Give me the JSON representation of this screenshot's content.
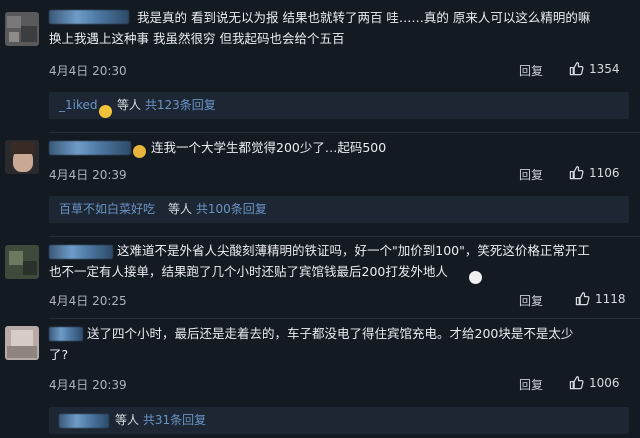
{
  "comments": [
    {
      "content": "我是真的 看到说无以为报 结果也就转了两百 哇……真的 原来人可以这么精明的嘛\n换上我遇上这种事 我虽然很穷 但我起码也会给个五百",
      "date": "4月4日 20:30",
      "reply_label": "回复",
      "likes": "1354",
      "replies": {
        "name": "_1iked",
        "middle": "等人",
        "link": "共123条回复"
      }
    },
    {
      "content": "连我一个大学生都觉得200少了…起码500",
      "date": "4月4日 20:39",
      "reply_label": "回复",
      "likes": "1106",
      "replies": {
        "name": "百草不如白菜好吃",
        "middle": "等人",
        "link": "共100条回复"
      }
    },
    {
      "content": "这难道不是外省人尖酸刻薄精明的铁证吗，好一个\"加价到100\"，笑死这价格正常开工\n也不一定有人接单，结果跑了几个小时还贴了宾馆钱最后200打发外地人",
      "date": "4月4日 20:25",
      "reply_label": "回复",
      "likes": "1118"
    },
    {
      "content": "送了四个小时，最后还是走着去的，车子都没电了得住宾馆充电。才给200块是不是太少\n了?",
      "date": "4月4日 20:39",
      "reply_label": "回复",
      "likes": "1006",
      "replies": {
        "middle": "等人",
        "link": "共31条回复"
      }
    }
  ],
  "colors": {
    "background": "#141a22",
    "link": "#6b93c4",
    "reply_box": "#1d2734"
  },
  "icons": [
    "thumbs-up-icon",
    "emoji-icon"
  ]
}
